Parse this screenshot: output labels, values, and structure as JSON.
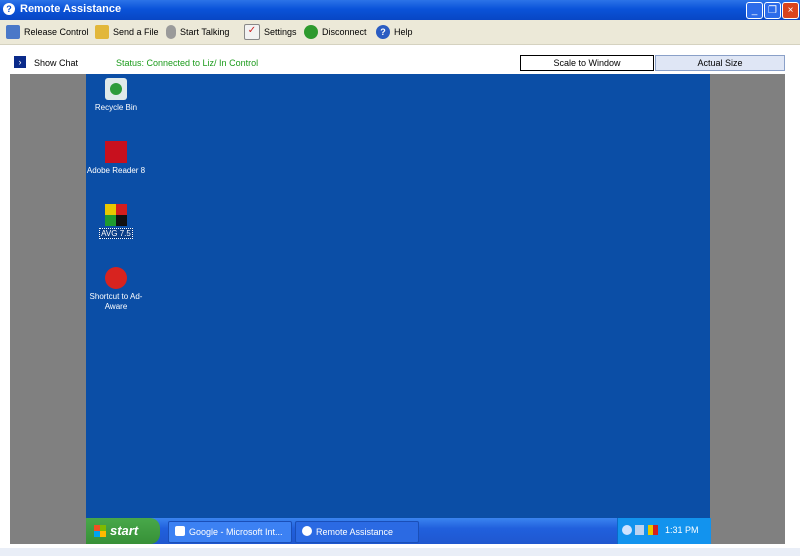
{
  "window": {
    "title": "Remote Assistance",
    "icon": "help-circle-icon",
    "controls": [
      "_",
      "❐",
      "×"
    ]
  },
  "toolbar": {
    "items": [
      {
        "label": "Release Control",
        "icon": "release-control-icon",
        "color": "#4a78c8"
      },
      {
        "label": "Send a File",
        "icon": "send-file-icon",
        "color": "#e2b73a"
      },
      {
        "label": "Start Talking",
        "icon": "microphone-icon",
        "color": "#9a9a9a"
      },
      {
        "label": "Settings",
        "icon": "settings-check-icon",
        "color": "#cc2222"
      },
      {
        "label": "Disconnect",
        "icon": "disconnect-icon",
        "color": "#2e9a2e"
      },
      {
        "label": "Help",
        "icon": "help-icon",
        "color": "#2a5cc2"
      }
    ]
  },
  "chat": {
    "label": "Show Chat",
    "icon": "chevron-right-icon"
  },
  "status": "Status: Connected to Liz/ In Control",
  "view": {
    "scale_label": "Scale to Window",
    "actual_label": "Actual Size"
  },
  "desktop": {
    "icons": [
      {
        "label": "Recycle Bin",
        "icon": "recycle-bin-icon"
      },
      {
        "label": "Adobe Reader 8",
        "icon": "adobe-reader-icon"
      },
      {
        "label": "AVG 7.5",
        "icon": "avg-icon"
      },
      {
        "label": "Shortcut to Ad-Aware",
        "icon": "ad-aware-icon"
      }
    ]
  },
  "taskbar": {
    "start_label": "start",
    "tasks": [
      {
        "label": "Google - Microsoft Int...",
        "icon": "internet-explorer-icon"
      },
      {
        "label": "Remote Assistance",
        "icon": "help-circle-icon"
      }
    ],
    "clock": "1:31 PM"
  },
  "colors": {
    "accent": "#0a53d9",
    "status_green": "#1b9b1b",
    "desktop_blue": "#0b4ea6"
  }
}
